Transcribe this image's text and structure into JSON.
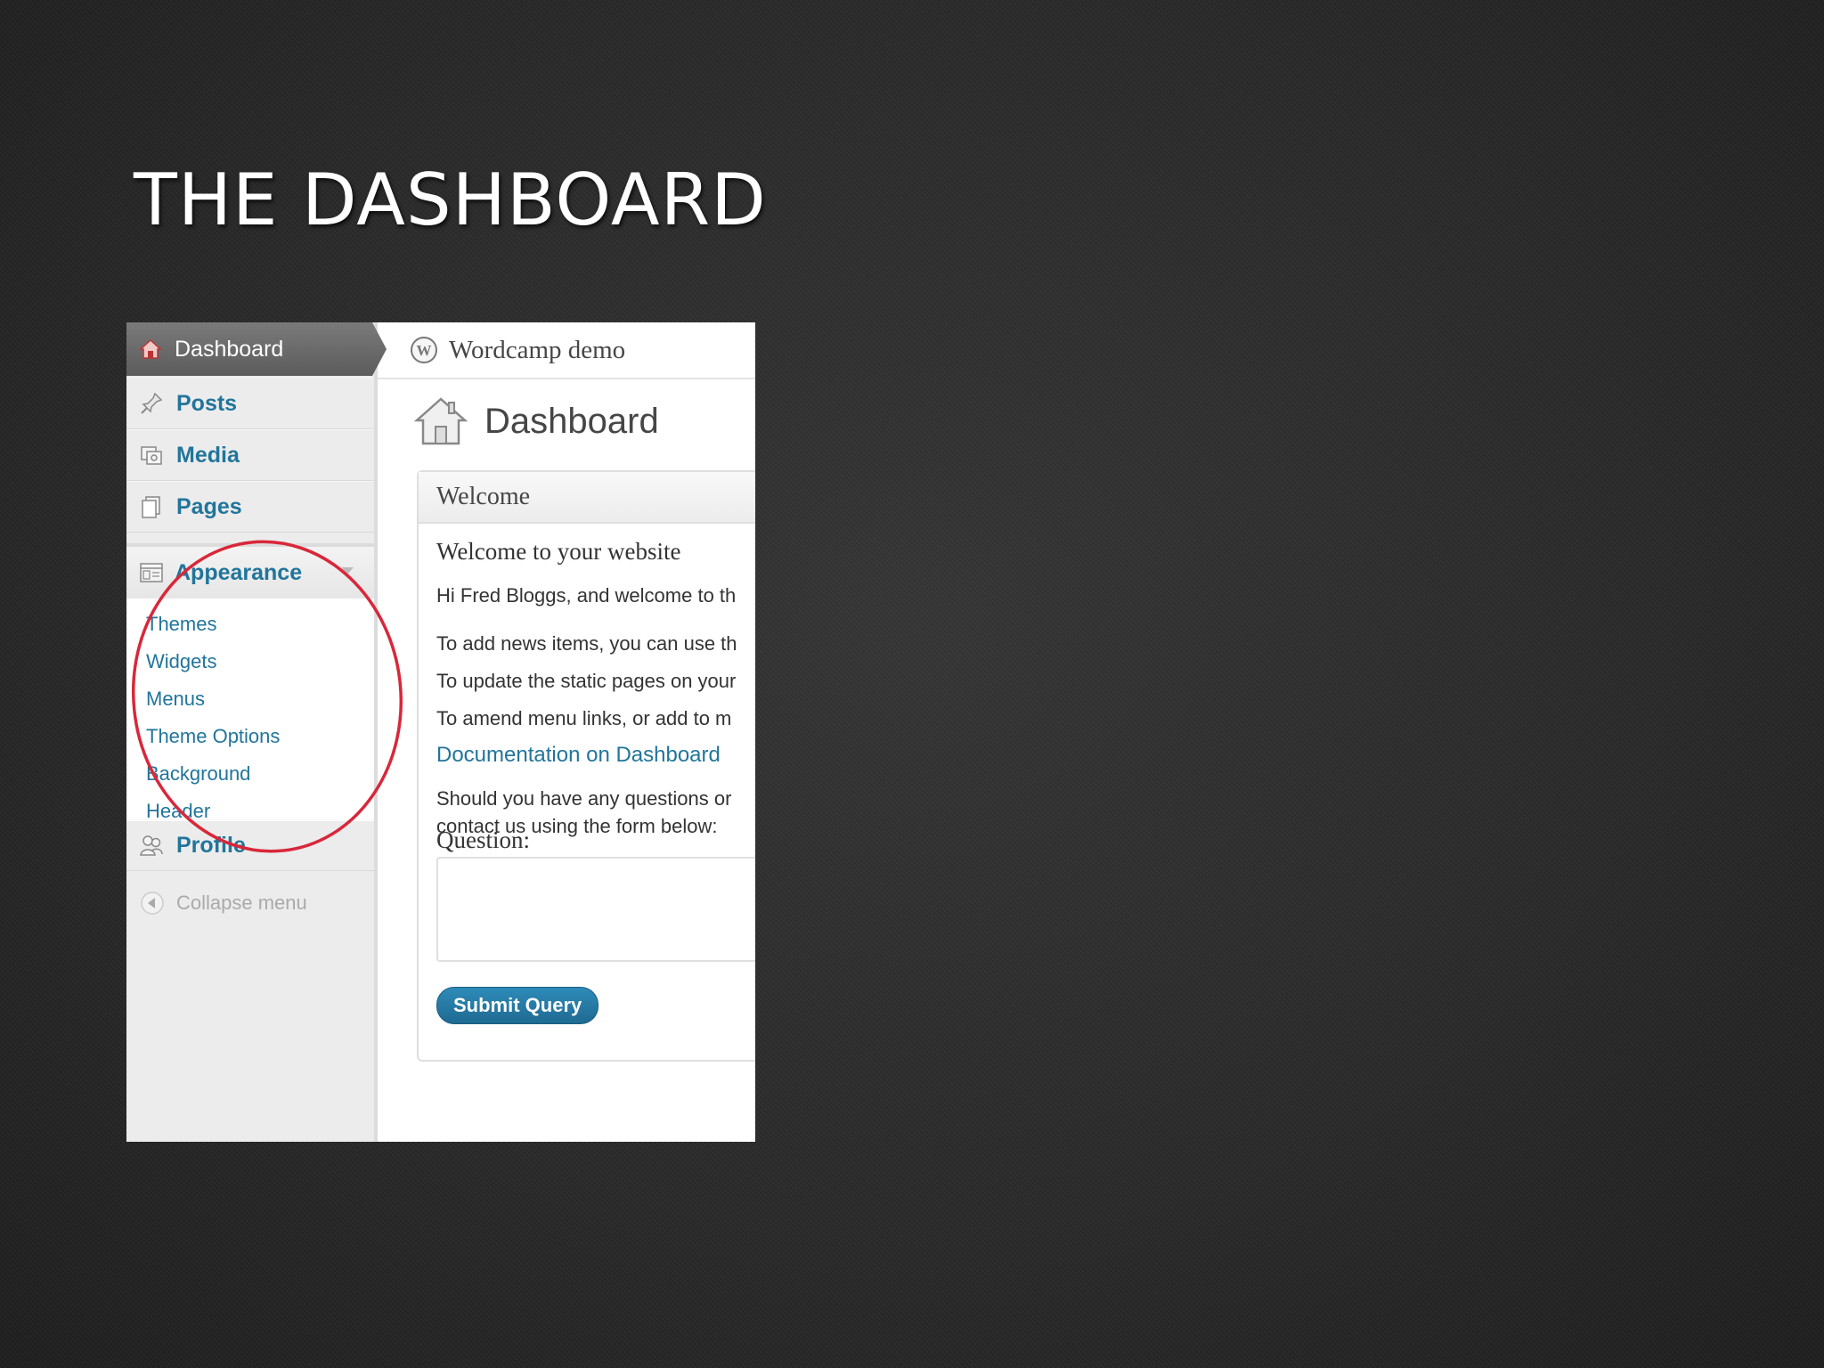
{
  "slide": {
    "title": "THE DASHBOARD"
  },
  "sidebar": {
    "dashboard_label": "Dashboard",
    "items": [
      {
        "label": "Posts",
        "icon": "pin-icon"
      },
      {
        "label": "Media",
        "icon": "media-icon"
      },
      {
        "label": "Pages",
        "icon": "pages-icon"
      }
    ],
    "appearance": {
      "label": "Appearance",
      "icon": "appearance-icon",
      "subitems": [
        "Themes",
        "Widgets",
        "Menus",
        "Theme Options",
        "Background",
        "Header"
      ]
    },
    "profile_label": "Profile",
    "collapse_label": "Collapse menu"
  },
  "topbar": {
    "site_name": "Wordcamp demo"
  },
  "page": {
    "title": "Dashboard"
  },
  "welcome": {
    "box_title": "Welcome",
    "heading": "Welcome to your website",
    "greeting": "Hi Fred Bloggs, and welcome to th",
    "line1": "To add news items, you can use th",
    "line2": "To update the static pages on your",
    "line3": "To amend menu links, or add to m",
    "doc_link": "Documentation on Dashboard",
    "questions_line1": "Should you have any questions or",
    "questions_line2": "contact us using the form below:",
    "question_label": "Question:",
    "submit_label": "Submit Query"
  },
  "colors": {
    "link": "#21759b",
    "annotation_circle": "#d9273a",
    "button": "#21759b"
  }
}
